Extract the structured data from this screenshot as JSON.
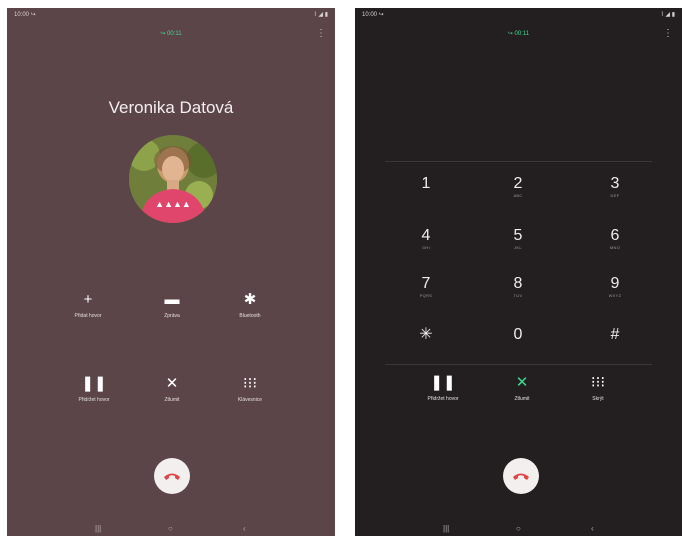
{
  "left_screen": {
    "status": {
      "time": "10:00 ↪",
      "icons": "⌇ ◢ ▮"
    },
    "call_timer": "↪ 00:11",
    "more_icon": "⋮",
    "contact_name": "Veronika Datová",
    "buttons": [
      {
        "icon": "+",
        "label": "Přidat hovor"
      },
      {
        "icon": "▬",
        "label": "Zpráva"
      },
      {
        "icon": "✱",
        "label": "Bluetooth"
      },
      {
        "icon": "❚❚",
        "label": "Přidržet hovor"
      },
      {
        "icon": "✕",
        "label": "Ztlumit"
      },
      {
        "icon": "⁝⁝⁝",
        "label": "Klávesnice"
      }
    ],
    "nav": {
      "recents": "|||",
      "home": "○",
      "back": "‹"
    }
  },
  "right_screen": {
    "status": {
      "time": "10:00 ↪",
      "icons": "⌇ ◢ ▮"
    },
    "call_timer": "↪ 00:11",
    "more_icon": "⋮",
    "keys": [
      {
        "digit": "1",
        "letters": ""
      },
      {
        "digit": "2",
        "letters": "ABC"
      },
      {
        "digit": "3",
        "letters": "DEF"
      },
      {
        "digit": "4",
        "letters": "GHI"
      },
      {
        "digit": "5",
        "letters": "JKL"
      },
      {
        "digit": "6",
        "letters": "MNO"
      },
      {
        "digit": "7",
        "letters": "PQRS"
      },
      {
        "digit": "8",
        "letters": "TUV"
      },
      {
        "digit": "9",
        "letters": "WXYZ"
      },
      {
        "digit": "✳",
        "letters": ""
      },
      {
        "digit": "0",
        "letters": ""
      },
      {
        "digit": "#",
        "letters": ""
      }
    ],
    "buttons": [
      {
        "icon": "❚❚",
        "label": "Přidržet hovor"
      },
      {
        "icon": "✕",
        "label": "Ztlumit"
      },
      {
        "icon": "⁝⁝⁝",
        "label": "Skrýt"
      }
    ],
    "nav": {
      "recents": "|||",
      "home": "○",
      "back": "‹"
    }
  },
  "colors": {
    "left_bg": "#5b4548",
    "right_bg": "#231f20",
    "end_call": "#e04646",
    "active_green": "#3ed98f"
  }
}
